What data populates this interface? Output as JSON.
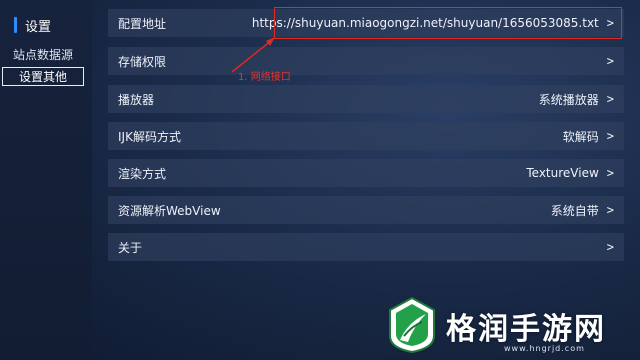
{
  "sidebar": {
    "header": "设置",
    "items": [
      {
        "label": "站点数据源",
        "selected": false
      },
      {
        "label": "设置其他",
        "selected": true
      }
    ]
  },
  "settings": [
    {
      "label": "配置地址",
      "value": "https://shuyuan.miaogongzi.net/shuyuan/1656053085.txt",
      "chevron": ">"
    },
    {
      "label": "存储权限",
      "value": "",
      "chevron": ">"
    },
    {
      "label": "播放器",
      "value": "系统播放器",
      "chevron": ">"
    },
    {
      "label": "IJK解码方式",
      "value": "软解码",
      "chevron": ">"
    },
    {
      "label": "渲染方式",
      "value": "TextureView",
      "chevron": ">"
    },
    {
      "label": "资源解析WebView",
      "value": "系统自带",
      "chevron": ">"
    },
    {
      "label": "关于",
      "value": "",
      "chevron": ">"
    }
  ],
  "annotation": {
    "label": "1. 网络接口",
    "color": "#e0291f"
  },
  "watermark": {
    "text": "格润手游网",
    "url": "www.hngrjd.com"
  },
  "colors": {
    "accent": "#2f8cff",
    "row_bg": "rgba(48,64,96,0.62)"
  }
}
